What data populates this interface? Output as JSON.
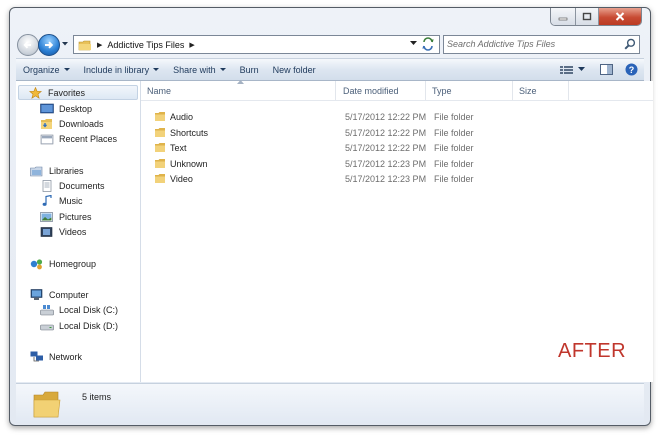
{
  "window": {
    "caption": {
      "minimize": "minimize",
      "maximize": "maximize",
      "close": "close"
    }
  },
  "address_bar": {
    "path": [
      "Addictive Tips Files"
    ],
    "search_placeholder": "Search Addictive Tips Files"
  },
  "toolbar": {
    "organize": "Organize",
    "include_in_library": "Include in library",
    "share_with": "Share with",
    "burn": "Burn",
    "new_folder": "New folder"
  },
  "navigation": {
    "favorites": {
      "label": "Favorites",
      "items": [
        "Desktop",
        "Downloads",
        "Recent Places"
      ]
    },
    "libraries": {
      "label": "Libraries",
      "items": [
        "Documents",
        "Music",
        "Pictures",
        "Videos"
      ]
    },
    "homegroup": {
      "label": "Homegroup"
    },
    "computer": {
      "label": "Computer",
      "items": [
        "Local Disk (C:)",
        "Local Disk (D:)"
      ]
    },
    "network": {
      "label": "Network"
    }
  },
  "columns": {
    "name": "Name",
    "date_modified": "Date modified",
    "type": "Type",
    "size": "Size"
  },
  "files": [
    {
      "name": "Audio",
      "date": "5/17/2012 12:22 PM",
      "type": "File folder"
    },
    {
      "name": "Shortcuts",
      "date": "5/17/2012 12:22 PM",
      "type": "File folder"
    },
    {
      "name": "Text",
      "date": "5/17/2012 12:22 PM",
      "type": "File folder"
    },
    {
      "name": "Unknown",
      "date": "5/17/2012 12:23 PM",
      "type": "File folder"
    },
    {
      "name": "Video",
      "date": "5/17/2012 12:23 PM",
      "type": "File folder"
    }
  ],
  "overlay_label": "AFTER",
  "details": {
    "count": "5 items"
  },
  "colors": {
    "after_label": "#c0362c",
    "toolbar_text": "#1e395b",
    "accent": "#2a7fd4"
  }
}
